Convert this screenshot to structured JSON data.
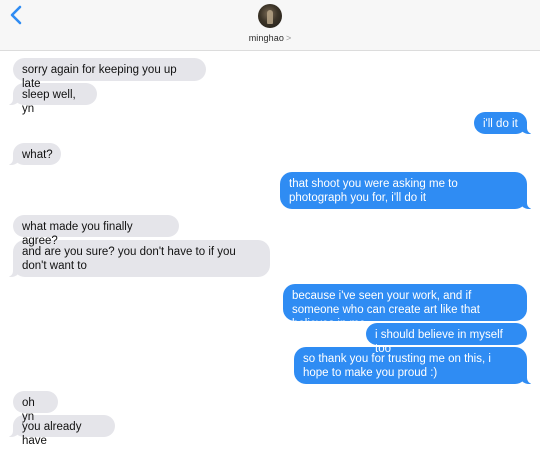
{
  "header": {
    "back_icon": "chevron-left-icon",
    "contact_name": "minghao",
    "contact_chevron": ">",
    "accent_color": "#2f8cf3"
  },
  "messages": [
    {
      "from": "them",
      "text": "sorry again for keeping you up late"
    },
    {
      "from": "them",
      "text": "sleep well, yn"
    },
    {
      "from": "me",
      "text": "i'll do it"
    },
    {
      "from": "them",
      "text": "what?"
    },
    {
      "from": "me",
      "text": "that shoot you were asking me to photograph you for, i'll do it"
    },
    {
      "from": "them",
      "text": "what made you finally agree?"
    },
    {
      "from": "them",
      "text": "and are you sure? you don't have to if you don't want to"
    },
    {
      "from": "me",
      "text": "because i've seen your work, and if someone who can create art like that believes in me"
    },
    {
      "from": "me",
      "text": "i should believe in myself too"
    },
    {
      "from": "me",
      "text": "so thank you for trusting me on this, i hope to make you proud :)"
    },
    {
      "from": "them",
      "text": "oh yn"
    },
    {
      "from": "them",
      "text": "you already have"
    }
  ]
}
